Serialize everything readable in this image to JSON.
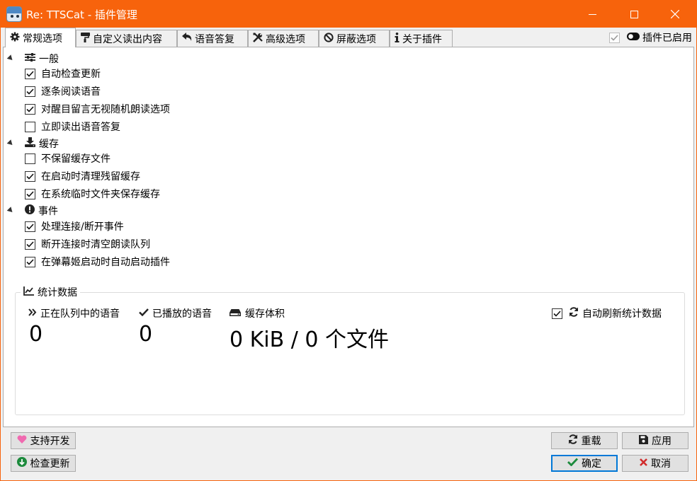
{
  "window": {
    "title": "Re: TTSCat - 插件管理",
    "accent_color": "#f7630c",
    "controls": [
      "minimize-icon",
      "maximize-icon",
      "close-icon"
    ]
  },
  "tabs": [
    {
      "label": "常规选项",
      "icon": "gear-icon",
      "active": true
    },
    {
      "label": "自定义读出内容",
      "icon": "paint-roller-icon",
      "active": false
    },
    {
      "label": "语音答复",
      "icon": "reply-icon",
      "active": false
    },
    {
      "label": "高级选项",
      "icon": "tools-icon",
      "active": false
    },
    {
      "label": "屏蔽选项",
      "icon": "ban-icon",
      "active": false
    },
    {
      "label": "关于插件",
      "icon": "info-icon",
      "active": false
    }
  ],
  "plugin_enabled": {
    "label": "插件已启用",
    "checked": true,
    "icon": "toggle-on-icon"
  },
  "groups": [
    {
      "title": "一般",
      "icon": "sliders-icon",
      "expanded": true,
      "items": [
        {
          "label": "自动检查更新",
          "checked": true
        },
        {
          "label": "逐条阅读语音",
          "checked": true
        },
        {
          "label": "对醒目留言无视随机朗读选项",
          "checked": true
        },
        {
          "label": "立即读出语音答复",
          "checked": false
        }
      ]
    },
    {
      "title": "缓存",
      "icon": "download-icon",
      "expanded": true,
      "items": [
        {
          "label": "不保留缓存文件",
          "checked": false
        },
        {
          "label": "在启动时清理残留缓存",
          "checked": true
        },
        {
          "label": "在系统临时文件夹保存缓存",
          "checked": true
        }
      ]
    },
    {
      "title": "事件",
      "icon": "exclamation-circle-icon",
      "expanded": true,
      "items": [
        {
          "label": "处理连接/断开事件",
          "checked": true
        },
        {
          "label": "断开连接时清空朗读队列",
          "checked": true
        },
        {
          "label": "在弹幕姬启动时自动启动插件",
          "checked": true
        }
      ]
    }
  ],
  "stats": {
    "title": "统计数据",
    "title_icon": "chart-line-icon",
    "queued": {
      "label": "正在队列中的语音",
      "value": "0",
      "icon": "double-chevron-right-icon"
    },
    "played": {
      "label": "已播放的语音",
      "value": "0",
      "icon": "check-icon"
    },
    "cache": {
      "label": "缓存体积",
      "value": "0 KiB / 0 个文件",
      "icon": "hdd-icon"
    },
    "auto_refresh": {
      "label": "自动刷新统计数据",
      "checked": true,
      "icon": "sync-icon"
    }
  },
  "buttons": {
    "support": {
      "label": "支持开发",
      "icon": "heart-icon"
    },
    "check_update": {
      "label": "检查更新",
      "icon": "arrow-down-circle-icon"
    },
    "reload": {
      "label": "重载",
      "icon": "sync-icon"
    },
    "apply": {
      "label": "应用",
      "icon": "save-icon"
    },
    "ok": {
      "label": "确定",
      "icon": "check-icon"
    },
    "cancel": {
      "label": "取消",
      "icon": "times-icon"
    }
  }
}
